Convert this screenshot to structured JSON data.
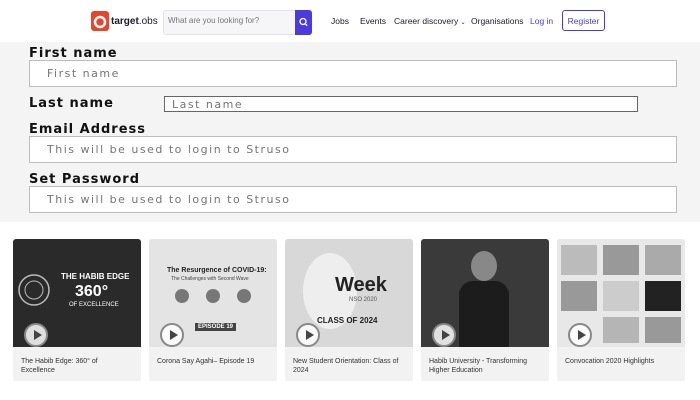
{
  "nav": {
    "logo_text": "target",
    "logo_suffix": "obs",
    "search_placeholder": "What are you looking for?",
    "links": [
      "Jobs",
      "Events",
      "Career discovery",
      "Organisations"
    ],
    "login": "Log in",
    "register": "Register"
  },
  "form": {
    "first_name_label": "First name",
    "first_name_placeholder": "First name",
    "last_name_label": "Last name",
    "last_name_placeholder": "Last name",
    "email_label": "Email Address",
    "email_placeholder": "This will be used to login to Struso",
    "password_label": "Set Password",
    "password_placeholder": "This will be used to login to Struso"
  },
  "videos": [
    {
      "title": "The Habib Edge: 360° of Excellence",
      "thumb_line1": "THE HABIB EDGE",
      "thumb_line2": "360°",
      "thumb_line3": "OF EXCELLENCE"
    },
    {
      "title": "Corona Say Agahi– Episode 19",
      "thumb_line1": "The Resurgence of COVID-19:",
      "thumb_line2": "The Challenges with Second Wave",
      "thumb_line3": "EPISODE 19"
    },
    {
      "title": "New Student Orientation: Class of 2024",
      "thumb_line1": "Week",
      "thumb_line2": "NSO 2020",
      "thumb_line3": "CLASS OF 2024"
    },
    {
      "title": "Habib University - Transforming Higher Education"
    },
    {
      "title": "Convocation 2020 Highlights"
    }
  ],
  "colors": {
    "accent": "#4b3bde",
    "brand": "#e8452c"
  }
}
